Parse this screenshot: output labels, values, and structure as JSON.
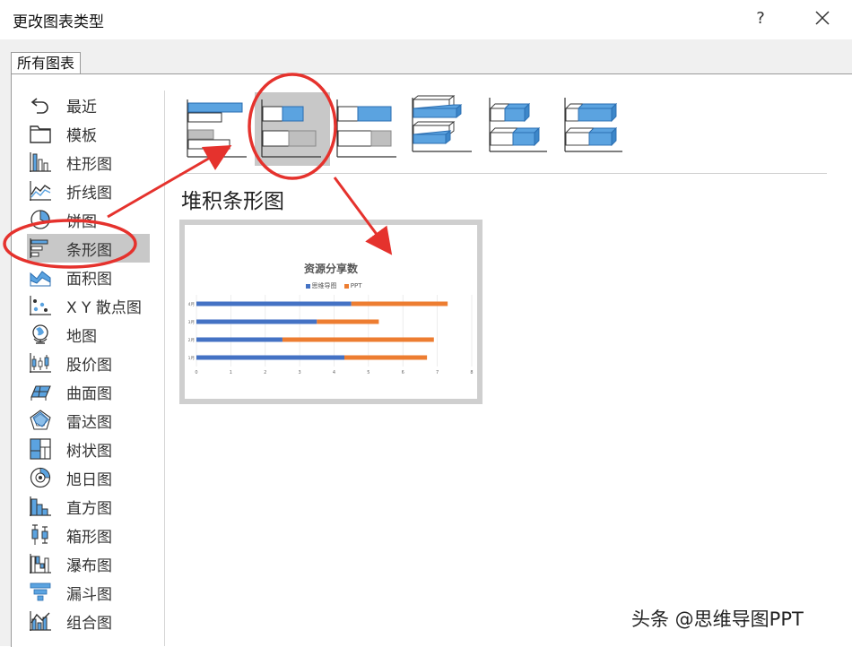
{
  "window": {
    "title": "更改图表类型",
    "help_label": "?"
  },
  "tab": {
    "label": "所有图表"
  },
  "sidebar": {
    "items": [
      {
        "label": "最近",
        "icon": "undo-icon"
      },
      {
        "label": "模板",
        "icon": "folder-icon"
      },
      {
        "label": "柱形图",
        "icon": "column-chart-icon"
      },
      {
        "label": "折线图",
        "icon": "line-chart-icon"
      },
      {
        "label": "饼图",
        "icon": "pie-chart-icon"
      },
      {
        "label": "条形图",
        "icon": "bar-chart-icon",
        "selected": true
      },
      {
        "label": "面积图",
        "icon": "area-chart-icon"
      },
      {
        "label": "X Y 散点图",
        "icon": "scatter-chart-icon"
      },
      {
        "label": "地图",
        "icon": "globe-icon"
      },
      {
        "label": "股价图",
        "icon": "stock-chart-icon"
      },
      {
        "label": "曲面图",
        "icon": "surface-chart-icon"
      },
      {
        "label": "雷达图",
        "icon": "radar-chart-icon"
      },
      {
        "label": "树状图",
        "icon": "treemap-icon"
      },
      {
        "label": "旭日图",
        "icon": "sunburst-icon"
      },
      {
        "label": "直方图",
        "icon": "histogram-icon"
      },
      {
        "label": "箱形图",
        "icon": "boxplot-icon"
      },
      {
        "label": "瀑布图",
        "icon": "waterfall-icon"
      },
      {
        "label": "漏斗图",
        "icon": "funnel-icon"
      },
      {
        "label": "组合图",
        "icon": "combo-chart-icon"
      }
    ]
  },
  "subtypes": {
    "selected_index": 1,
    "selected_title": "堆积条形图",
    "items": [
      {
        "icon": "clustered-bar-icon"
      },
      {
        "icon": "stacked-bar-icon"
      },
      {
        "icon": "percent-stacked-bar-icon"
      },
      {
        "icon": "3d-clustered-bar-icon"
      },
      {
        "icon": "3d-stacked-bar-icon"
      },
      {
        "icon": "3d-percent-stacked-bar-icon"
      }
    ]
  },
  "colors": {
    "accent_blue": "#4472c4",
    "accent_orange": "#ed7d31",
    "icon_blue": "#5ba3e0",
    "annotation_red": "#e5322d",
    "selection_gray": "#c8c8c8"
  },
  "chart_data": {
    "type": "bar",
    "stacked": true,
    "orientation": "horizontal",
    "title": "资源分享数",
    "categories": [
      "1月",
      "2月",
      "3月",
      "4月"
    ],
    "series": [
      {
        "name": "思维导图",
        "color": "#4472c4",
        "values": [
          4.3,
          2.5,
          3.5,
          4.5
        ]
      },
      {
        "name": "PPT",
        "color": "#ed7d31",
        "values": [
          2.4,
          4.4,
          1.8,
          2.8
        ]
      }
    ],
    "xlim": [
      0,
      8
    ],
    "xticks": [
      "0",
      "1",
      "2",
      "3",
      "4",
      "5",
      "6",
      "7",
      "8"
    ],
    "legend_position": "top",
    "grid": true
  },
  "watermark": "头条 @思维导图PPT"
}
